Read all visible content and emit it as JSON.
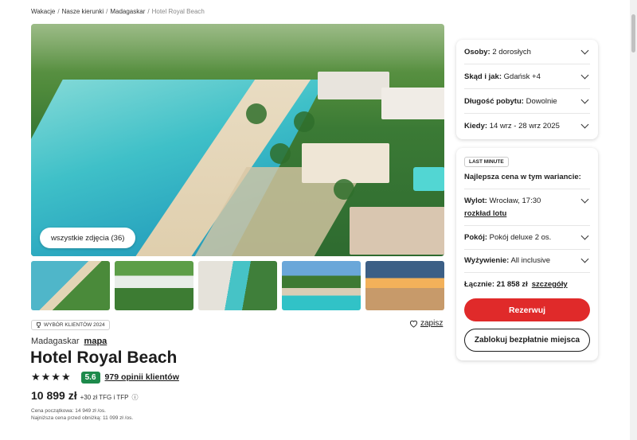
{
  "breadcrumb": {
    "items": [
      "Wakacje",
      "Nasze kierunki",
      "Madagaskar"
    ],
    "current": "Hotel Royal Beach",
    "separator": "/"
  },
  "gallery": {
    "all_photos_label": "wszystkie zdjęcia (36)"
  },
  "badges": {
    "clients_choice": "WYBÓR KLIENTÓW 2024"
  },
  "save": {
    "label": "zapisz",
    "icon": "heart-icon"
  },
  "hotel": {
    "country": "Madagaskar",
    "map_link": "mapa",
    "name": "Hotel Royal Beach",
    "stars": 4,
    "stars_text": "★★★★",
    "score": "5.6",
    "reviews": "979 opinii klientów"
  },
  "price": {
    "amount": "10 899 zł",
    "extra": "+30 zł TFG i TFP",
    "start_price": "Cena początkowa: 14 949 zł /os.",
    "lowest_before_discount": "Najniższa cena przed obniżką: 11 099 zł /os."
  },
  "search_card": {
    "rows": [
      {
        "label": "Osoby:",
        "value": "2 dorosłych"
      },
      {
        "label": "Skąd i jak:",
        "value": "Gdańsk +4"
      },
      {
        "label": "Długość pobytu:",
        "value": "Dowolnie"
      },
      {
        "label": "Kiedy:",
        "value": "14 wrz - 28 wrz 2025"
      }
    ]
  },
  "offer_card": {
    "badge": "LAST MINUTE",
    "best_price": "Najlepsza cena w tym wariancie:",
    "flight_label": "Wylot:",
    "flight_value": "Wrocław, 17:30",
    "flight_link": "rozkład lotu",
    "room_label": "Pokój:",
    "room_value": "Pokój deluxe 2 os.",
    "board_label": "Wyżywienie:",
    "board_value": "All inclusive",
    "total_label": "Łącznie:",
    "total_value": "21 858 zł",
    "details_link": "szczegóły",
    "book_button": "Rezerwuj",
    "hold_button": "Zablokuj bezpłatnie miejsca"
  },
  "colors": {
    "accent": "#e02a2a",
    "score": "#1d8a4b"
  }
}
